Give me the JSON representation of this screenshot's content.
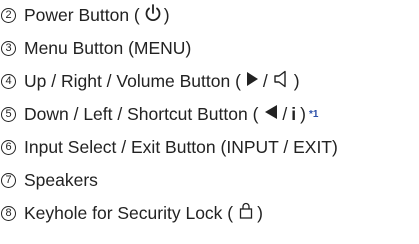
{
  "items": [
    {
      "num": "2",
      "pre": "Power Button (",
      "post": ")"
    },
    {
      "num": "3",
      "text": "Menu Button (MENU)"
    },
    {
      "num": "4",
      "pre": "Up / Right / Volume Button (",
      "mid": "/",
      "post": ")"
    },
    {
      "num": "5",
      "pre": "Down / Left / Shortcut Button (",
      "mid": "/",
      "bold": "i",
      "post": ")",
      "note": "*1"
    },
    {
      "num": "6",
      "text": "Input Select / Exit Button (INPUT / EXIT)"
    },
    {
      "num": "7",
      "text": "Speakers"
    },
    {
      "num": "8",
      "pre": "Keyhole for Security Lock (",
      "post": ")"
    }
  ],
  "colors": {
    "text": "#222222",
    "footnote": "#2b4fa8"
  },
  "icons": [
    "power-icon",
    "play-right-icon",
    "speaker-icon",
    "triangle-left-icon",
    "lock-icon"
  ]
}
